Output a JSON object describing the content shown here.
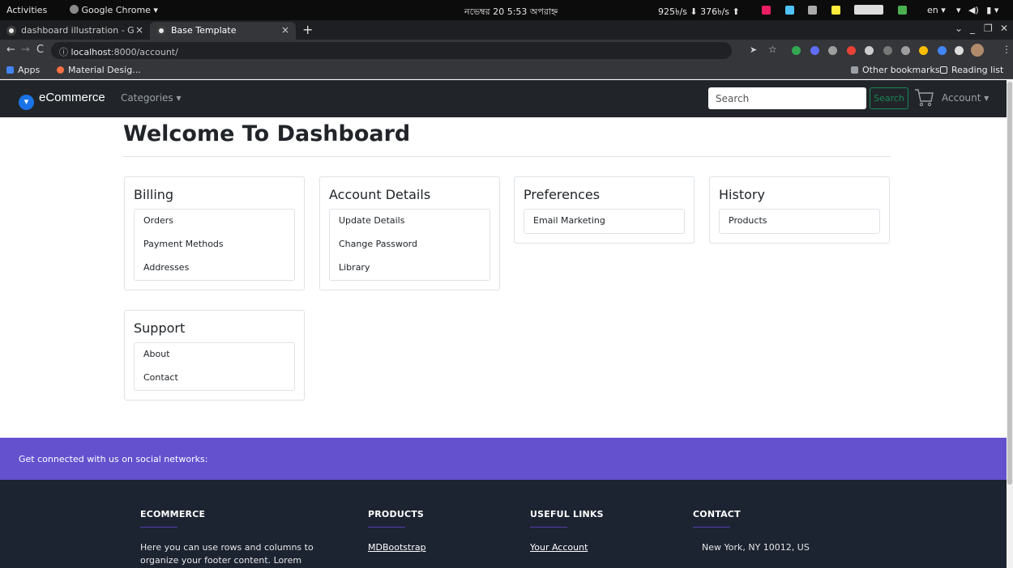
{
  "os_bar": {
    "activities": "Activities",
    "app_menu": "Google Chrome ▾",
    "clock": "নভেম্বর 20  5:53 অপরাহ্ন",
    "net_speed": "925৳/s ⬇  376৳/s ⬆",
    "lang": "en ▾"
  },
  "tabs": [
    {
      "title": "dashboard illustration - G"
    },
    {
      "title": "Base Template"
    }
  ],
  "omnibar": {
    "url_host": "localhost",
    "url_rest": ":8000/account/"
  },
  "bookmarks": {
    "apps": "Apps",
    "material": "Material Desig...",
    "other": "Other bookmarks",
    "reading": "Reading list"
  },
  "navbar": {
    "brand": "eCommerce",
    "categories": "Categories ▾",
    "search_placeholder": "Search",
    "search_button": "Search",
    "account": "Account ▾"
  },
  "main": {
    "title": "Welcome To Dashboard",
    "cards": [
      {
        "title": "Billing",
        "items": [
          "Orders",
          "Payment Methods",
          "Addresses"
        ]
      },
      {
        "title": "Account Details",
        "items": [
          "Update Details",
          "Change Password",
          "Library"
        ]
      },
      {
        "title": "Preferences",
        "items": [
          "Email Marketing"
        ]
      },
      {
        "title": "History",
        "items": [
          "Products"
        ]
      },
      {
        "title": "Support",
        "items": [
          "About",
          "Contact"
        ]
      }
    ]
  },
  "footer": {
    "social_text": "Get connected with us on social networks:",
    "columns": [
      {
        "heading": "ECOMMERCE",
        "text": "Here you can use rows and columns to organize your footer content. Lorem"
      },
      {
        "heading": "PRODUCTS",
        "text": "MDBootstrap"
      },
      {
        "heading": "USEFUL LINKS",
        "text": "Your Account"
      },
      {
        "heading": "CONTACT",
        "text": "New York, NY 10012, US"
      }
    ]
  },
  "colors": {
    "navbar_bg": "#212529",
    "social_bar": "#6351ce",
    "footer_bg": "#1c2331",
    "search_green": "#198754"
  }
}
